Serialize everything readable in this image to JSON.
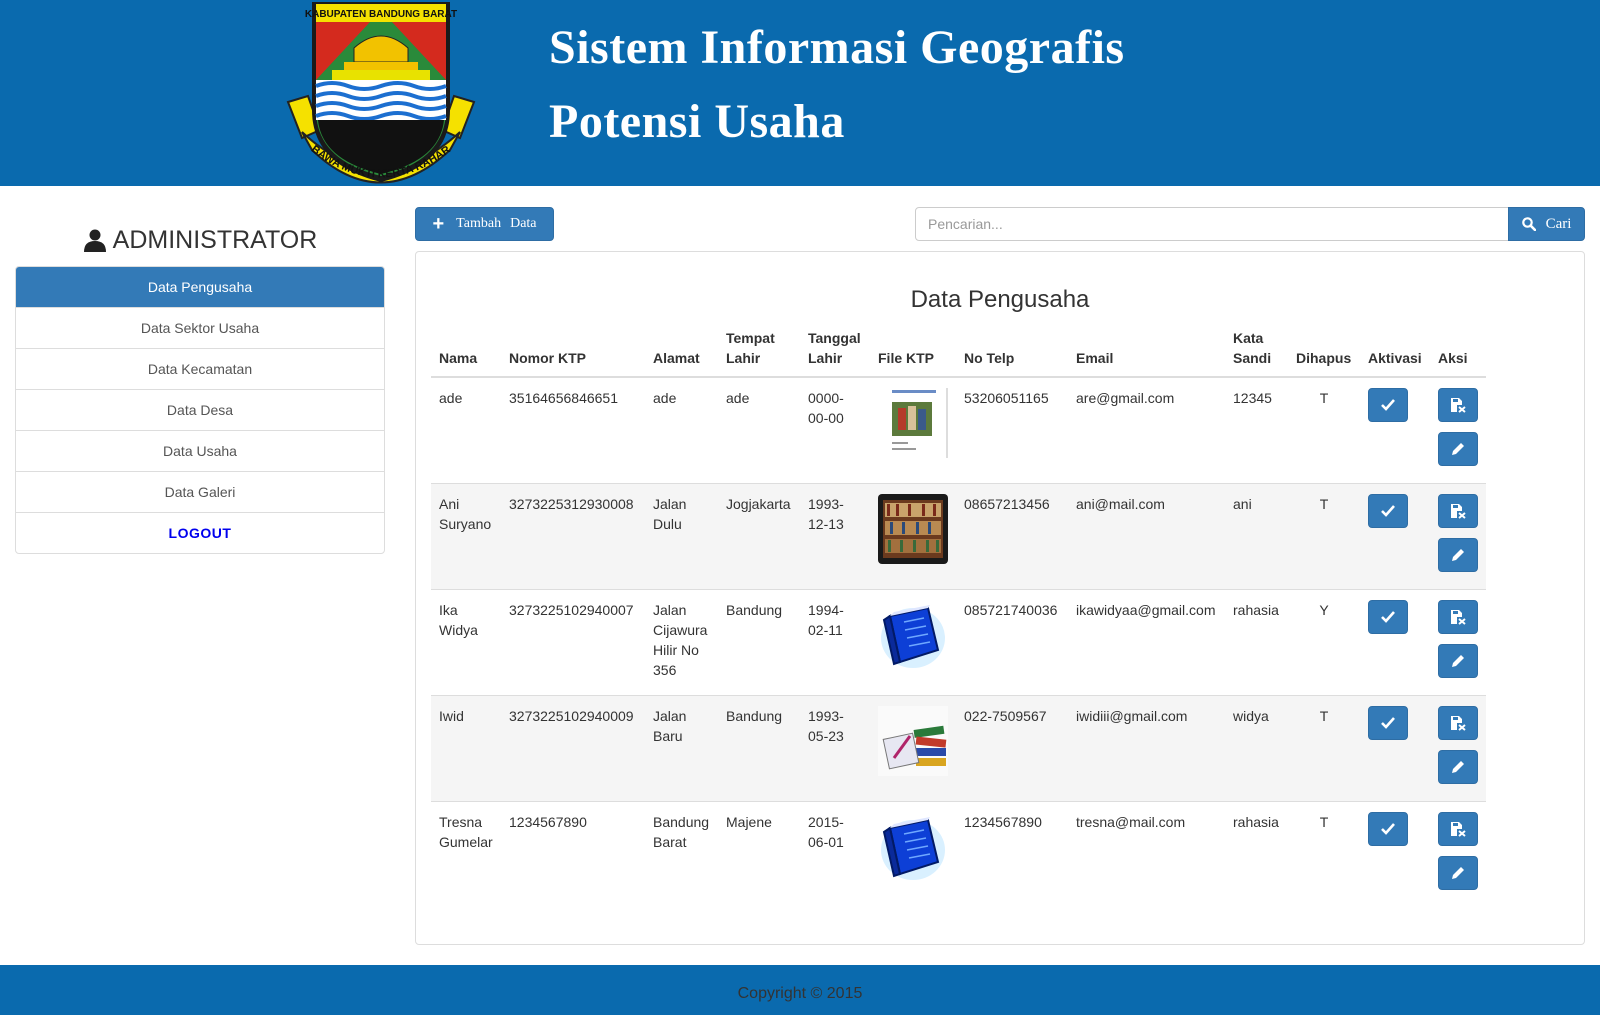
{
  "header": {
    "logo_top_text": "KABUPATEN BANDUNG BARAT",
    "logo_ribbon_text": "WIBAWA MUKTI KERTA RAHARJA",
    "title_line1": "Sistem Informasi Geografis",
    "title_line2": "Potensi Usaha",
    "bg_color": "#0a6aae"
  },
  "sidebar": {
    "heading": "ADMINISTRATOR",
    "items": [
      {
        "label": "Data Pengusaha",
        "active": true
      },
      {
        "label": "Data Sektor Usaha"
      },
      {
        "label": "Data Kecamatan"
      },
      {
        "label": "Data Desa"
      },
      {
        "label": "Data Usaha"
      },
      {
        "label": "Data Galeri"
      }
    ],
    "logout": "LOGOUT"
  },
  "toolbar": {
    "add_label_1": "Tambah",
    "add_label_2": "Data",
    "search_placeholder": "Pencarian...",
    "search_value": "",
    "search_button": "Cari"
  },
  "panel": {
    "title": "Data Pengusaha",
    "columns": {
      "nama": "Nama",
      "ktp": "Nomor KTP",
      "alamat": "Alamat",
      "tempat_lahir_1": "Tempat",
      "tempat_lahir_2": "Lahir",
      "tanggal_lahir_1": "Tanggal",
      "tanggal_lahir_2": "Lahir",
      "file_ktp": "File KTP",
      "no_telp": "No Telp",
      "email": "Email",
      "kata_sandi_1": "Kata",
      "kata_sandi_2": "Sandi",
      "dihapus": "Dihapus",
      "aktivasi": "Aktivasi",
      "aksi": "Aksi"
    },
    "rows": [
      {
        "nama_1": "ade",
        "nama_2": "",
        "ktp": "35164656846651",
        "alamat": [
          "ade"
        ],
        "tempat": "ade",
        "tanggal_1": "0000-",
        "tanggal_2": "00-00",
        "file": "document-thumbnail",
        "telp": "53206051165",
        "email": "are@gmail.com",
        "sandi": "12345",
        "dihapus": "T"
      },
      {
        "nama_1": "Ani",
        "nama_2": "Suryano",
        "ktp": "3273225312930008",
        "alamat": [
          "Jalan",
          "Dulu"
        ],
        "tempat": "Jogjakarta",
        "tanggal_1": "1993-",
        "tanggal_2": "12-13",
        "file": "bookshelf-thumbnail",
        "telp": "08657213456",
        "email": "ani@mail.com",
        "sandi": "ani",
        "dihapus": "T"
      },
      {
        "nama_1": "Ika",
        "nama_2": "Widya",
        "ktp": "3273225102940007",
        "alamat": [
          "Jalan",
          "Cijawura",
          "Hilir No",
          "356"
        ],
        "tempat": "Bandung",
        "tanggal_1": "1994-",
        "tanggal_2": "02-11",
        "file": "blue-book-thumbnail",
        "telp": "085721740036",
        "email": "ikawidyaa@gmail.com",
        "sandi": "rahasia",
        "dihapus": "Y"
      },
      {
        "nama_1": "Iwid",
        "nama_2": "",
        "ktp": "3273225102940009",
        "alamat": [
          "Jalan",
          "Baru"
        ],
        "tempat": "Bandung",
        "tanggal_1": "1993-",
        "tanggal_2": "05-23",
        "file": "books-thumbnail",
        "telp": "022-7509567",
        "email": "iwidiii@gmail.com",
        "sandi": "widya",
        "dihapus": "T"
      },
      {
        "nama_1": "Tresna",
        "nama_2": "Gumelar",
        "ktp": "1234567890",
        "alamat": [
          "Bandung",
          "Barat"
        ],
        "tempat": "Majene",
        "tanggal_1": "2015-",
        "tanggal_2": "06-01",
        "file": "blue-book-thumbnail",
        "telp": "1234567890",
        "email": "tresna@mail.com",
        "sandi": "rahasia",
        "dihapus": "T"
      }
    ]
  },
  "footer": {
    "copyright": "Copyright © 2015"
  },
  "colors": {
    "primary": "#337ab7",
    "header": "#0a6aae",
    "logout": "#0000ee"
  }
}
